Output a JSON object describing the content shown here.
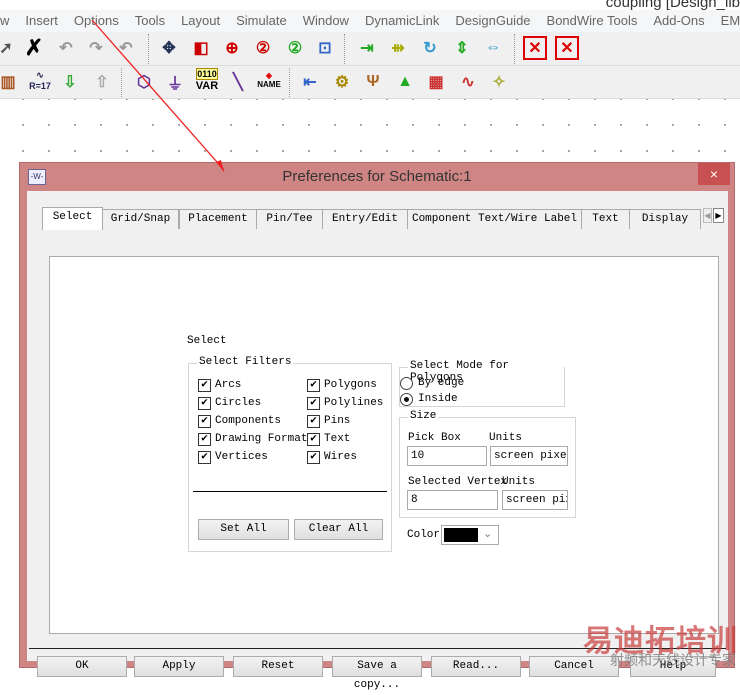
{
  "app": {
    "title": "coupling [Design_lib"
  },
  "menu": [
    "w",
    "Insert",
    "Options",
    "Tools",
    "Layout",
    "Simulate",
    "Window",
    "DynamicLink",
    "DesignGuide",
    "BondWire Tools",
    "Add-Ons",
    "EM"
  ],
  "toolbar2_text": {
    "var_top": "0110",
    "var": "VAR",
    "name": "NAME",
    "r17": "R=17"
  },
  "dialog": {
    "title": "Preferences for Schematic:1",
    "close": "×",
    "icon_text": "-W-",
    "tabs": [
      "Select",
      "Grid/Snap",
      "Placement",
      "Pin/Tee",
      "Entry/Edit",
      "Component Text/Wire Label",
      "Text",
      "Display"
    ],
    "active_tab": "Select",
    "section_label": "Select",
    "filters": {
      "legend": "Select Filters",
      "items": [
        {
          "label": "Arcs",
          "checked": true
        },
        {
          "label": "Circles",
          "checked": true
        },
        {
          "label": "Components",
          "checked": true
        },
        {
          "label": "Drawing Format",
          "checked": true
        },
        {
          "label": "Vertices",
          "checked": true
        },
        {
          "label": "Polygons",
          "checked": true
        },
        {
          "label": "Polylines",
          "checked": true
        },
        {
          "label": "Pins",
          "checked": true
        },
        {
          "label": "Text",
          "checked": true
        },
        {
          "label": "Wires",
          "checked": true
        }
      ],
      "set_all": "Set All",
      "clear_all": "Clear All"
    },
    "poly_mode": {
      "legend": "Select Mode for Polygons",
      "options": [
        "By edge",
        "Inside"
      ],
      "selected": "Inside"
    },
    "size": {
      "legend": "Size",
      "pick_box_label": "Pick Box",
      "pick_box_value": "10",
      "units_label": "Units",
      "pick_units": "screen pixels",
      "vertex_label": "Selected Vertex",
      "vertex_value": "8",
      "vertex_units_label": "Units",
      "vertex_units": "screen pixels"
    },
    "color": {
      "label": "Color",
      "value": "#000000"
    },
    "buttons": [
      "OK",
      "Apply",
      "Reset",
      "Save a copy...",
      "Read...",
      "Cancel",
      "Help"
    ]
  },
  "watermark": {
    "main": "易迪拓培训",
    "sub": "射频和天线设计专家"
  }
}
